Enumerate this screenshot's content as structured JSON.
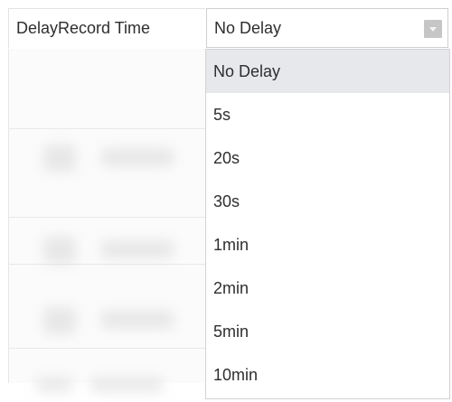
{
  "field": {
    "label": "DelayRecord Time",
    "selected_value": "No Delay",
    "arrow_icon": "dropdown-arrow-icon"
  },
  "dropdown": {
    "selected_index": 0,
    "options": [
      {
        "label": "No Delay"
      },
      {
        "label": "5s"
      },
      {
        "label": "20s"
      },
      {
        "label": "30s"
      },
      {
        "label": "1min"
      },
      {
        "label": "2min"
      },
      {
        "label": "5min"
      },
      {
        "label": "10min"
      }
    ]
  },
  "colors": {
    "highlight": "#e6e8ec",
    "border": "#cfcfcf",
    "text": "#2e2e2e",
    "arrow_box": "#c6c6c6"
  }
}
